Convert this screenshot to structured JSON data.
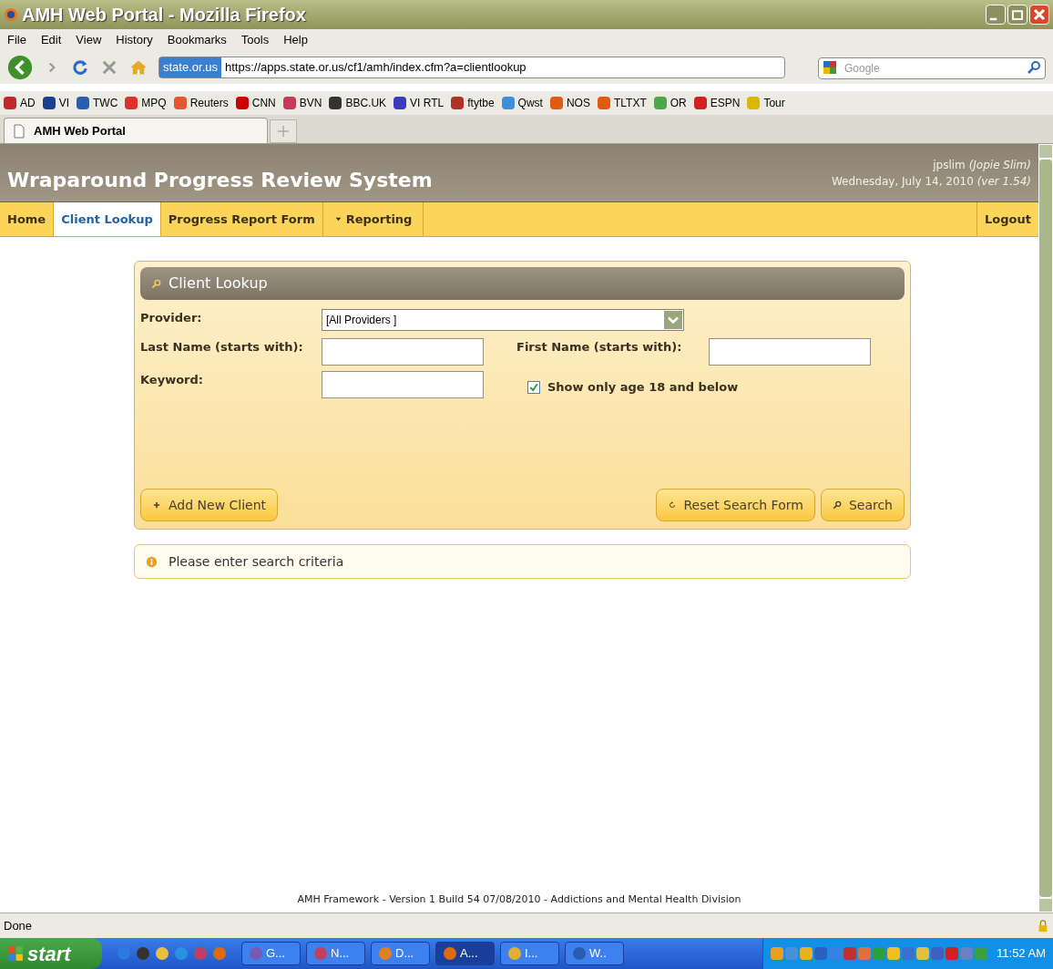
{
  "window": {
    "title": "AMH Web Portal - Mozilla Firefox"
  },
  "menu": [
    "File",
    "Edit",
    "View",
    "History",
    "Bookmarks",
    "Tools",
    "Help"
  ],
  "address": {
    "site": "state.or.us",
    "url": "https://apps.state.or.us/cf1/amh/index.cfm?a=clientlookup"
  },
  "search": {
    "placeholder": "Google"
  },
  "bookmarks": [
    {
      "label": "AD",
      "color": "#c0282d"
    },
    {
      "label": "VI",
      "color": "#1d3f8f"
    },
    {
      "label": "TWC",
      "color": "#2a5db0"
    },
    {
      "label": "MPQ",
      "color": "#d8322a"
    },
    {
      "label": "Reuters",
      "color": "#e4572e"
    },
    {
      "label": "CNN",
      "color": "#cc0000"
    },
    {
      "label": "BVN",
      "color": "#c83a5a"
    },
    {
      "label": "BBC.UK",
      "color": "#333333"
    },
    {
      "label": "VI RTL",
      "color": "#3a3ac0"
    },
    {
      "label": "ftytbe",
      "color": "#b0302a"
    },
    {
      "label": "Qwst",
      "color": "#3c8fd8"
    },
    {
      "label": "NOS",
      "color": "#e05a10"
    },
    {
      "label": "TLTXT",
      "color": "#e05a10"
    },
    {
      "label": "OR",
      "color": "#4aa84a"
    },
    {
      "label": "ESPN",
      "color": "#d02020"
    },
    {
      "label": "Tour",
      "color": "#d8b800"
    }
  ],
  "tab": {
    "label": "AMH Web Portal"
  },
  "app": {
    "title": "Wraparound Progress Review System",
    "user": "jpslim",
    "user_full": "(Jopie Slim)",
    "date": "Wednesday, July 14, 2010",
    "version": "(ver 1.54)"
  },
  "nav": [
    {
      "label": "Home",
      "selected": false,
      "kind": "link"
    },
    {
      "label": "Client Lookup",
      "selected": true,
      "kind": "link"
    },
    {
      "label": "Progress Report Form",
      "selected": false,
      "kind": "link"
    },
    {
      "label": "Reporting",
      "selected": false,
      "kind": "dropdown"
    }
  ],
  "logout": "Logout",
  "panel": {
    "title": "Client Lookup",
    "provider_label": "Provider:",
    "provider_value": "[All Providers ]",
    "last_name_label": "Last Name (starts with):",
    "first_name_label": "First Name (starts with):",
    "keyword_label": "Keyword:",
    "age_filter": {
      "label": "Show only age 18 and below",
      "checked": true
    },
    "add_button": "Add New Client",
    "reset_button": "Reset Search Form",
    "search_button": "Search"
  },
  "message": "Please enter search criteria",
  "footer": "AMH Framework - Version 1 Build 54 07/08/2010 - Addictions and Mental Health Division",
  "status": "Done",
  "taskbar": {
    "start": "start",
    "tasks": [
      {
        "label": "G...",
        "selected": false,
        "color": "#7a5ab0"
      },
      {
        "label": "N...",
        "selected": false,
        "color": "#c04060"
      },
      {
        "label": "D...",
        "selected": false,
        "color": "#e08020"
      },
      {
        "label": "A...",
        "selected": true,
        "color": "#e06a10"
      },
      {
        "label": "I...",
        "selected": false,
        "color": "#e0b030"
      },
      {
        "label": "W..",
        "selected": false,
        "color": "#2a5db0"
      }
    ],
    "clock": "11:52 AM"
  }
}
